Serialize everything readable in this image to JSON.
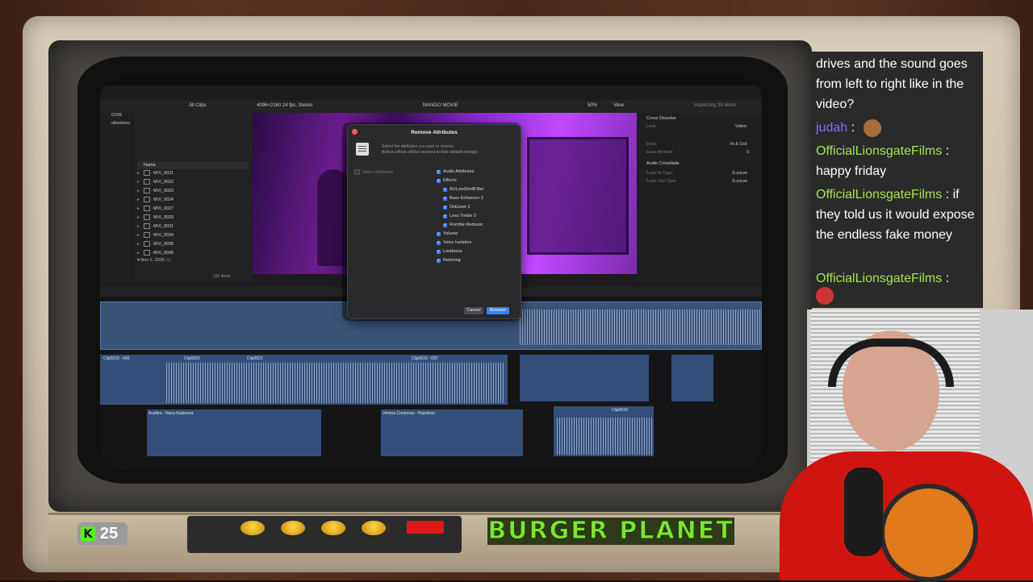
{
  "app": {
    "toolbar": {
      "library_filter": "All Clips",
      "format": "4096×2160 24 fps, Stereo",
      "project_title": "MANGO MOVIE",
      "zoom": "50%",
      "view": "View",
      "inspector_title": "Inspecting 35 items"
    },
    "sidebar": {
      "items": [
        "OVIE",
        "ollections"
      ]
    },
    "browser": {
      "header": "Name",
      "clips": [
        "MVI_0021",
        "MVI_0022",
        "MVI_0023",
        "MVI_0024",
        "MVI_0027",
        "MVI_0029",
        "MVI_0031",
        "MVI_0034",
        "MVI_0035",
        "MVI_0036"
      ],
      "date_group": "Nov 2, 2025",
      "date_group_count": "(2)",
      "clip_count": "231 items"
    },
    "inspector": {
      "section": "Cross Dissolve",
      "look_label": "Look",
      "look_value": "Video",
      "ease_label": "Ease",
      "ease_value": "In & Out",
      "ease_amount_label": "Ease Amount",
      "ease_amount_value": "0",
      "audio_section": "Audio Crossfade",
      "fade_in_label": "Fade In Type",
      "fade_in_value": "S-curve",
      "fade_out_label": "Fade Out Type",
      "fade_out_value": "S-curve"
    },
    "timeline": {
      "clip_labels": [
        "Clip0018 - 042",
        "Clip0020",
        "Clip0021",
        "Clip0022 - 037",
        "Avalitra - Nana Kastoena",
        "Jimena Contreras - Hopeless",
        "Clip0033"
      ]
    }
  },
  "dialog": {
    "title": "Remove Attributes",
    "desc_line1": "Select the attributes you want to remove.",
    "desc_line2": "Built-in effects will be restored to their default settings.",
    "video_attributes": "Video Attributes",
    "audio_attributes": "Audio Attributes",
    "effects": "Effects",
    "effect_items": [
      "AULowShelfFilter",
      "Bass Enhancer 2",
      "DeEsser 2",
      "Less Treble 2",
      "Rumble Reducer"
    ],
    "other_items": [
      "Volume",
      "Voice Isolation",
      "Loudness",
      "Retiming"
    ],
    "cancel": "Cancel",
    "remove": "Remove"
  },
  "overlay": {
    "kick_icon": "K",
    "kick_count": "25",
    "sponsor": "BURGER PLANET"
  },
  "chat": {
    "msg1_text": "drives and the sound goes from left to right like in the video?",
    "msg2_user": "judah",
    "msg2_sep": ":",
    "msg3_user": "OfficialLionsgateFilms",
    "msg3_sep": ":",
    "msg3_text": "happy friday",
    "msg4_user": "OfficialLionsgateFilms",
    "msg4_sep": ":",
    "msg4_text": "if they told us it would expose the endless fake money",
    "msg5_user": "OfficialLionsgateFilms",
    "msg5_sep": ":"
  }
}
